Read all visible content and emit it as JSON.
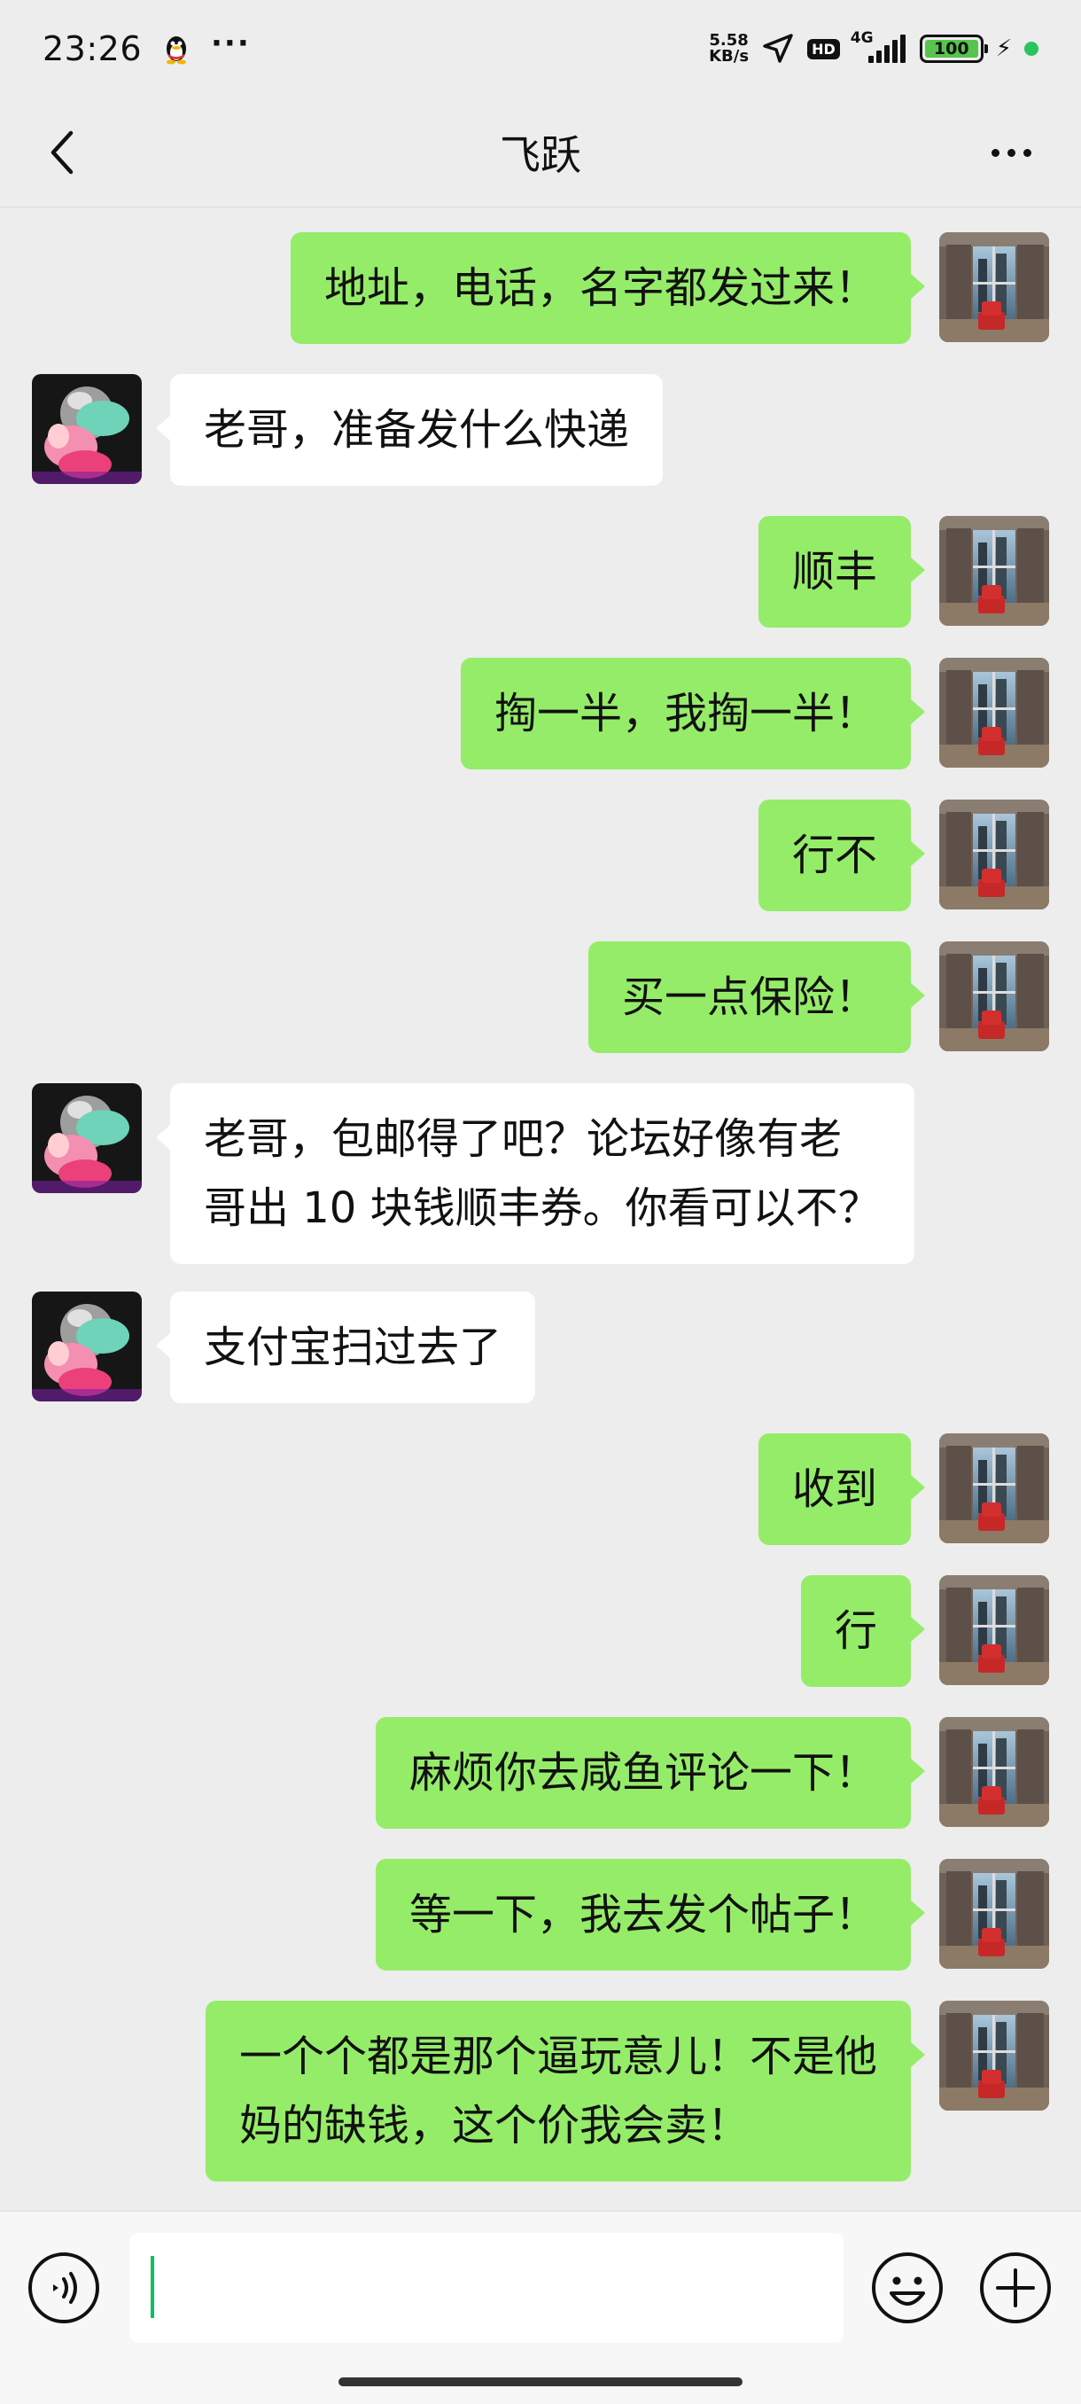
{
  "status_bar": {
    "time": "23:26",
    "more_dots": "···",
    "net_speed_value": "5.58",
    "net_speed_unit": "KB/s",
    "hd": "HD",
    "network": "4G",
    "battery": "100",
    "bolt": "⚡"
  },
  "header": {
    "title": "飞跃"
  },
  "messages": [
    {
      "from": "self",
      "text": "地址，电话，名字都发过来！"
    },
    {
      "from": "peer",
      "text": "老哥，准备发什么快递"
    },
    {
      "from": "self",
      "text": "顺丰"
    },
    {
      "from": "self",
      "text": "掏一半，我掏一半！"
    },
    {
      "from": "self",
      "text": "行不"
    },
    {
      "from": "self",
      "text": "买一点保险！"
    },
    {
      "from": "peer",
      "lines": [
        "老哥，包邮得了吧？论坛好像有老",
        "哥出 10 块钱顺丰券。你看可以不？"
      ]
    },
    {
      "from": "peer",
      "text": "支付宝扫过去了"
    },
    {
      "from": "self",
      "text": "收到"
    },
    {
      "from": "self",
      "text": "行"
    },
    {
      "from": "self",
      "text": "麻烦你去咸鱼评论一下！"
    },
    {
      "from": "self",
      "text": "等一下，我去发个帖子！"
    },
    {
      "from": "self",
      "lines": [
        "一个个都是那个逼玩意儿！不是他",
        "妈的缺钱，这个价我会卖！"
      ]
    }
  ],
  "input": {
    "value": ""
  },
  "colors": {
    "self_bubble": "#95EC69",
    "peer_bubble": "#FFFFFF",
    "background": "#EDEDED",
    "caret": "#07C160"
  }
}
